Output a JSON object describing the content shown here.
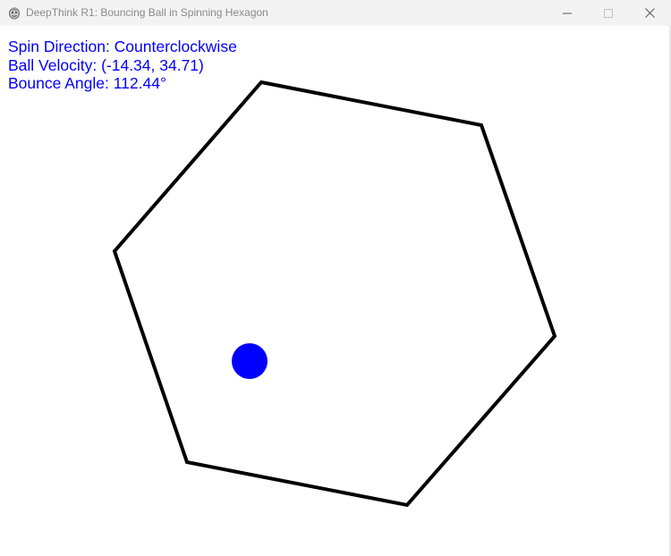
{
  "window": {
    "title": "DeepThink R1: Bouncing Ball in Spinning Hexagon",
    "controls": {
      "minimize_icon": "minimize-icon",
      "maximize_icon": "maximize-icon",
      "close_icon": "close-icon"
    }
  },
  "hud": {
    "spin_direction": "Spin Direction: Counterclockwise",
    "ball_velocity": "Ball Velocity: (-14.34, 34.71)",
    "bounce_angle": "Bounce Angle: 112.44°"
  },
  "scene": {
    "hexagon_color": "#000000",
    "ball_color": "#0000ff",
    "hud_color": "#0000ff"
  }
}
